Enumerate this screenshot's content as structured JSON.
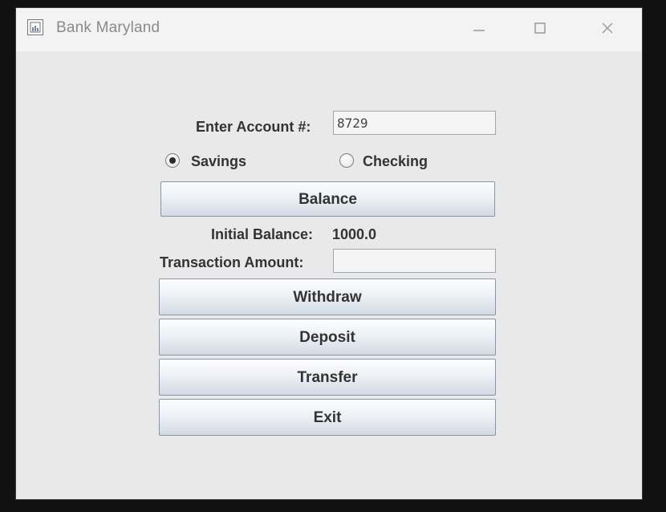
{
  "window": {
    "title": "Bank Maryland"
  },
  "account": {
    "label": "Enter Account #:",
    "value": "8729"
  },
  "account_type": {
    "options": [
      {
        "label": "Savings",
        "selected": true
      },
      {
        "label": "Checking",
        "selected": false
      }
    ]
  },
  "buttons": {
    "balance": "Balance",
    "withdraw": "Withdraw",
    "deposit": "Deposit",
    "transfer": "Transfer",
    "exit": "Exit"
  },
  "balance": {
    "label": "Initial Balance:",
    "value": "1000.0"
  },
  "transaction": {
    "label": "Transaction Amount:",
    "value": ""
  },
  "icons": {
    "app": "app-window-icon",
    "minimize": "minimize-icon",
    "maximize": "maximize-icon",
    "close": "close-icon"
  }
}
